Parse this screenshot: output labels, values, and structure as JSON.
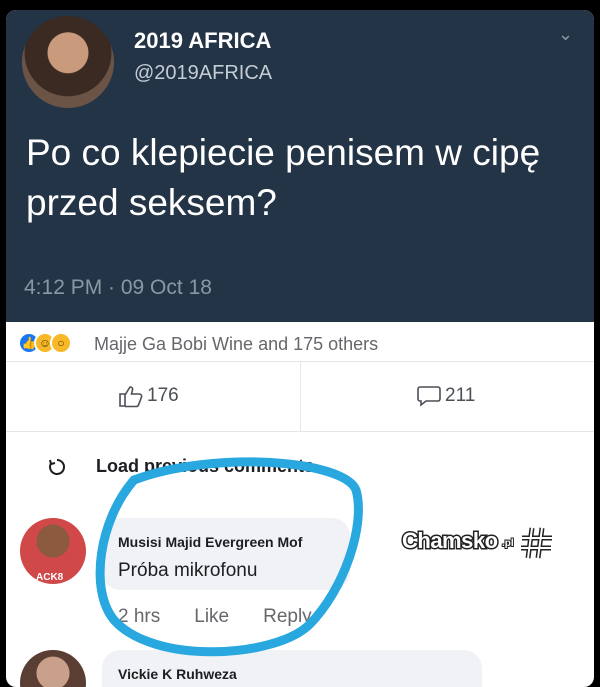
{
  "tweet": {
    "name": "2019 AFRICA",
    "handle": "@2019AFRICA",
    "text": "Po co klepiecie penisem w cipę przed seksem?",
    "time": "4:12 PM · 09 Oct 18"
  },
  "reactions": {
    "summary": "Majje Ga Bobi Wine and 175 others"
  },
  "actions": {
    "likes": "176",
    "comments": "211"
  },
  "comments": {
    "load_previous": "Load previous comments...",
    "items": [
      {
        "author": "Musisi Majid Evergreen Mof",
        "body": "Próba mikrofonu",
        "avatar_tag": "ACK8",
        "age": "2 hrs",
        "like_label": "Like",
        "reply_label": "Reply"
      },
      {
        "author": "Vickie K Ruhweza"
      }
    ]
  },
  "watermark": {
    "brand": "Chamsko",
    "tld": ".pl"
  },
  "colors": {
    "tweet_bg": "#243447",
    "annotation": "#29a8e0",
    "facebook_blue": "#1877f2"
  }
}
